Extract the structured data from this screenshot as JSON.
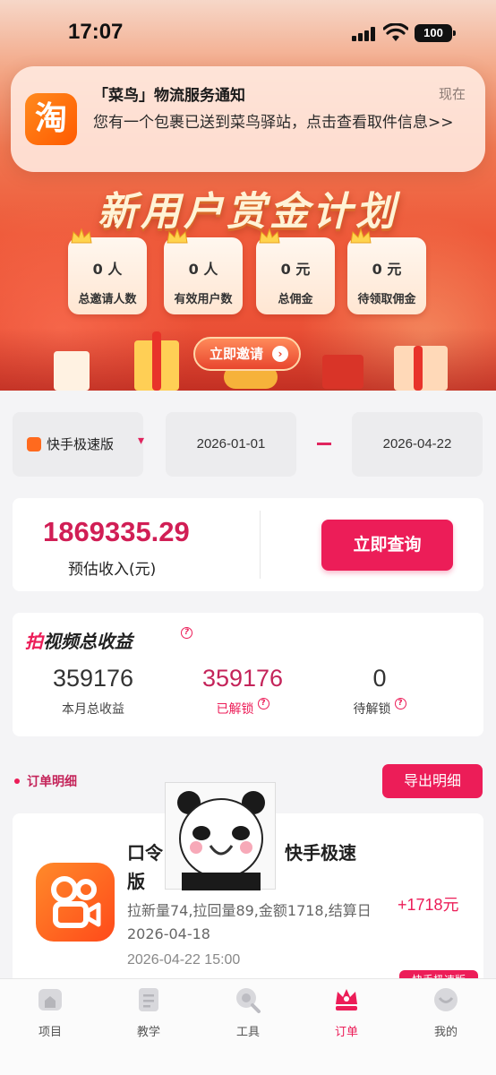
{
  "status_bar": {
    "time": "17:07",
    "battery": "100"
  },
  "notification": {
    "app_icon_glyph": "淘",
    "title": "「菜鸟」物流服务通知",
    "time": "现在",
    "body": "您有一个包裹已送到菜鸟驿站，点击查看取件信息>>"
  },
  "banner": {
    "title": "新用户赏金计划",
    "stats": [
      {
        "value": "0 人",
        "label": "总邀请人数"
      },
      {
        "value": "0 人",
        "label": "有效用户数"
      },
      {
        "value": "0 元",
        "label": "总佣金"
      },
      {
        "value": "0 元",
        "label": "待领取佣金"
      }
    ],
    "invite_label": "立即邀请"
  },
  "filter": {
    "app_selected": "快手极速版",
    "start_date": "2026-01-01",
    "end_date": "2026-04-22"
  },
  "income": {
    "value": "1869335.29",
    "label": "预估收入(元)",
    "query_label": "立即查询"
  },
  "earnings": {
    "title_prefix": "拍",
    "title_rest": "视频总收益",
    "this_month": {
      "value": "359176",
      "label": "本月总收益"
    },
    "unlocked": {
      "value": "359176",
      "label": "已解锁"
    },
    "pending": {
      "value": "0",
      "label": "待解锁"
    }
  },
  "orders": {
    "header": "订单明细",
    "export_label": "导出明细",
    "items": [
      {
        "title_part1": "口令",
        "title_part2": "快手极速",
        "title_part3": "版",
        "desc": "拉新量74,拉回量89,金额1718,结算日2026-04-18",
        "amount": "+1718元",
        "time": "2026-04-22 15:00",
        "tag": "快手极速版"
      }
    ]
  },
  "tabs": [
    {
      "label": "项目",
      "icon": "home-icon"
    },
    {
      "label": "教学",
      "icon": "document-icon"
    },
    {
      "label": "工具",
      "icon": "search-icon"
    },
    {
      "label": "订单",
      "icon": "crown-icon",
      "active": true
    },
    {
      "label": "我的",
      "icon": "profile-icon"
    }
  ],
  "colors": {
    "accent": "#ec1d58",
    "banner_orange": "#ee5a3a"
  }
}
